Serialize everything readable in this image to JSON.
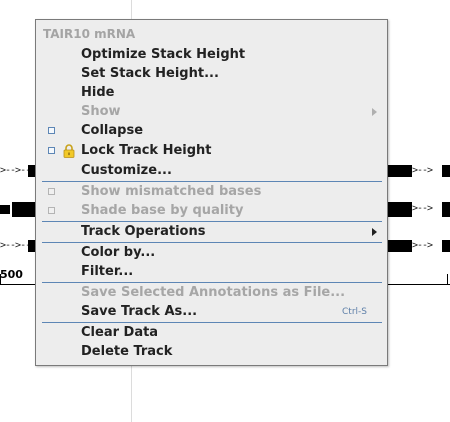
{
  "background": {
    "ruler_label": "500"
  },
  "menu": {
    "title": "TAIR10 mRNA",
    "items": [
      {
        "label": "Optimize Stack Height"
      },
      {
        "label": "Set Stack Height..."
      },
      {
        "label": "Hide"
      },
      {
        "label": "Show",
        "disabled": true,
        "submenu": true
      },
      {
        "label": "Collapse",
        "checkbox": true
      },
      {
        "label": "Lock Track Height",
        "checkbox": true,
        "icon": "lock-icon"
      },
      {
        "label": "Customize..."
      },
      {
        "label": "Show mismatched bases",
        "disabled": true,
        "checkbox": true
      },
      {
        "label": "Shade base by quality",
        "disabled": true,
        "checkbox": true
      },
      {
        "label": "Track Operations",
        "submenu": true
      },
      {
        "label": "Color by..."
      },
      {
        "label": "Filter..."
      },
      {
        "label": "Save Selected Annotations as File...",
        "disabled": true
      },
      {
        "label": "Save Track As...",
        "shortcut": "Ctrl-S"
      },
      {
        "label": "Clear Data"
      },
      {
        "label": "Delete Track"
      }
    ]
  },
  "colors": {
    "menu_bg": "#ededed",
    "separator": "#5d86b5",
    "disabled_text": "#a6a6a6"
  }
}
